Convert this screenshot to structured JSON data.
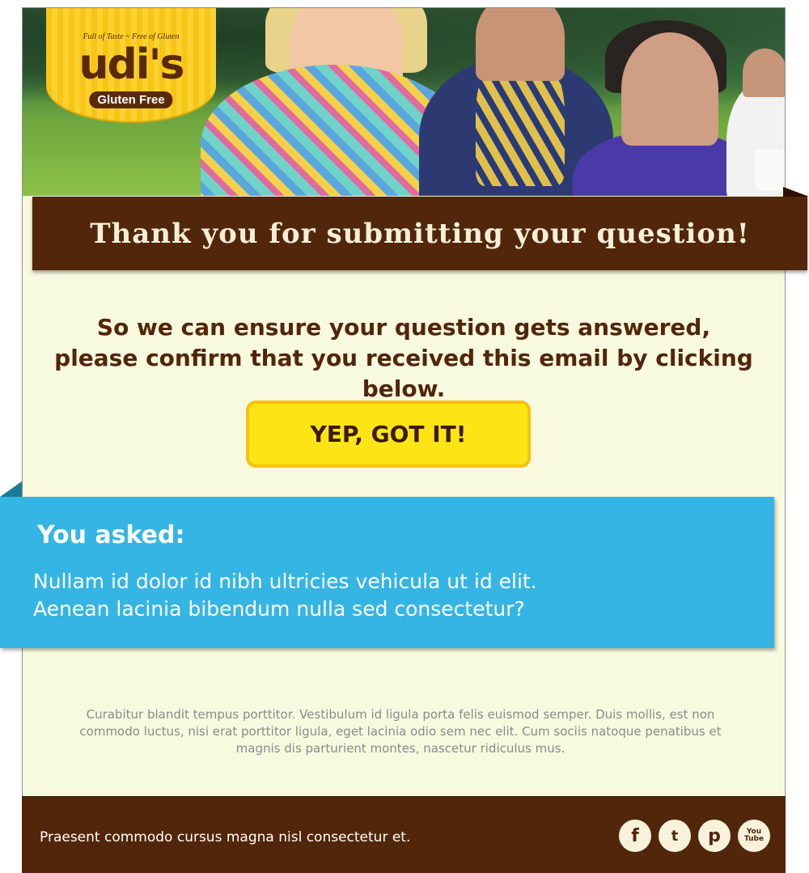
{
  "brand": {
    "tagline": "Full of Taste ~ Free of Gluten",
    "logo_text": "udi's",
    "sub_logo": "Gluten Free",
    "colors": {
      "brown": "#52260a",
      "cream": "#f8fae0",
      "yellow": "#fde414",
      "blue": "#35b5e4"
    }
  },
  "header": {
    "title": "Thank you for submitting your question!"
  },
  "instruction": {
    "line1": "So we can ensure your question gets answered,",
    "line2": "please confirm that you received this email by clicking below."
  },
  "cta": {
    "label": "YEP, GOT IT!"
  },
  "question": {
    "label": "You asked:",
    "line1": "Nullam id dolor id nibh ultricies vehicula ut id elit.",
    "line2": "Aenean lacinia bibendum nulla sed consectetur?"
  },
  "fineprint": {
    "text": "Curabitur blandit tempus porttitor. Vestibulum id ligula porta felis euismod semper. Duis mollis, est non commodo luctus, nisi erat porttitor ligula, eget lacinia odio sem nec elit. Cum sociis natoque penatibus et magnis dis parturient montes, nascetur ridiculus mus."
  },
  "footer": {
    "text": "Praesent commodo cursus magna nisl consectetur et.",
    "social": [
      {
        "name": "facebook-icon",
        "glyph": "f"
      },
      {
        "name": "twitter-icon",
        "glyph": "t"
      },
      {
        "name": "pinterest-icon",
        "glyph": "p"
      },
      {
        "name": "youtube-icon",
        "glyph_top": "You",
        "glyph_bottom": "Tube"
      }
    ]
  }
}
